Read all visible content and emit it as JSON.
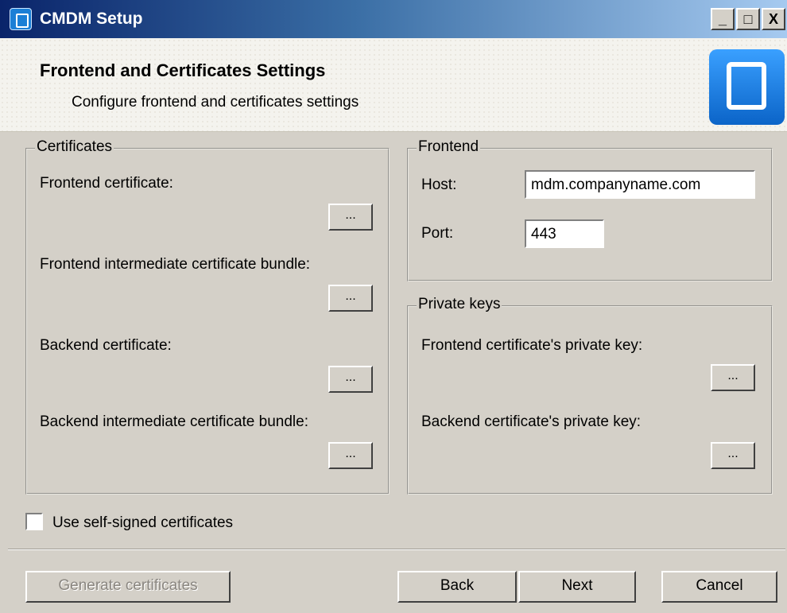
{
  "window": {
    "title": "CMDM Setup",
    "minimize": "_",
    "maximize": "□",
    "close": "X"
  },
  "header": {
    "title": "Frontend and Certificates Settings",
    "subtitle": "Configure frontend and certificates settings"
  },
  "certificates": {
    "legend": "Certificates",
    "frontend_cert_label": "Frontend certificate:",
    "frontend_intermediate_label": "Frontend intermediate certificate bundle:",
    "backend_cert_label": "Backend certificate:",
    "backend_intermediate_label": "Backend intermediate certificate bundle:",
    "browse_label": "..."
  },
  "frontend": {
    "legend": "Frontend",
    "host_label": "Host:",
    "host_value": "mdm.companyname.com",
    "port_label": "Port:",
    "port_value": "443"
  },
  "private_keys": {
    "legend": "Private keys",
    "frontend_key_label": "Frontend certificate's private key:",
    "backend_key_label": "Backend certificate's private key:",
    "browse_label": "..."
  },
  "options": {
    "self_signed_label": "Use self-signed certificates",
    "self_signed_checked": false
  },
  "footer": {
    "generate_label": "Generate certificates",
    "back_label": "Back",
    "next_label": "Next",
    "cancel_label": "Cancel"
  }
}
